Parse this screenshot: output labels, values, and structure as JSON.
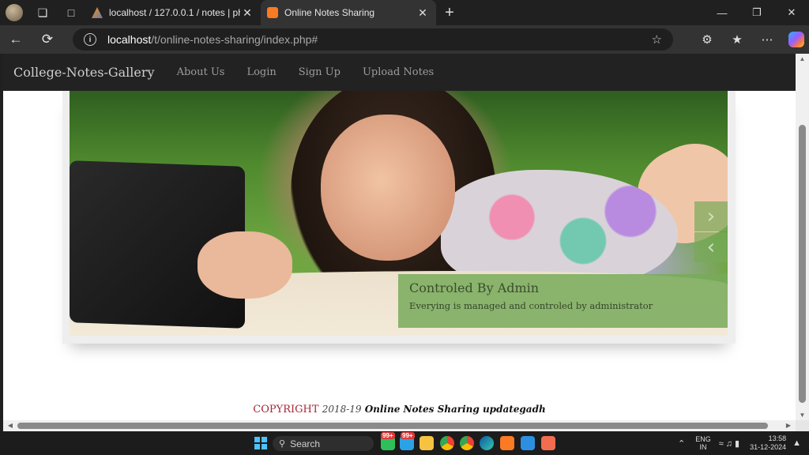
{
  "browser": {
    "tabs": [
      {
        "title": "localhost / 127.0.0.1 / notes | php",
        "active": false
      },
      {
        "title": "Online Notes Sharing",
        "active": true
      }
    ],
    "new_tab_icon": "+",
    "address": {
      "host": "localhost",
      "path": "/t/online-notes-sharing/index.php#"
    }
  },
  "site": {
    "brand": "College-Notes-Gallery",
    "nav": [
      "About Us",
      "Login",
      "Sign Up",
      "Upload Notes"
    ],
    "slide": {
      "caption_title": "Controled By Admin",
      "caption_text": "Everying is managed and controled by administrator",
      "next_symbol": "›",
      "prev_symbol": "‹"
    },
    "footer": {
      "copyright": "COPYRIGHT",
      "years": "2018-19",
      "name": "Online Notes Sharing updategadh"
    }
  },
  "taskbar": {
    "search_label": "Search",
    "badges": [
      "99+",
      "99+"
    ],
    "language": {
      "line1": "ENG",
      "line2": "IN"
    },
    "time": "13:58",
    "date": "31-12-2024"
  },
  "colors": {
    "caption_bg": "#78aa5a",
    "footer_copyright": "#a4283a",
    "site_navbar": "#222222"
  }
}
